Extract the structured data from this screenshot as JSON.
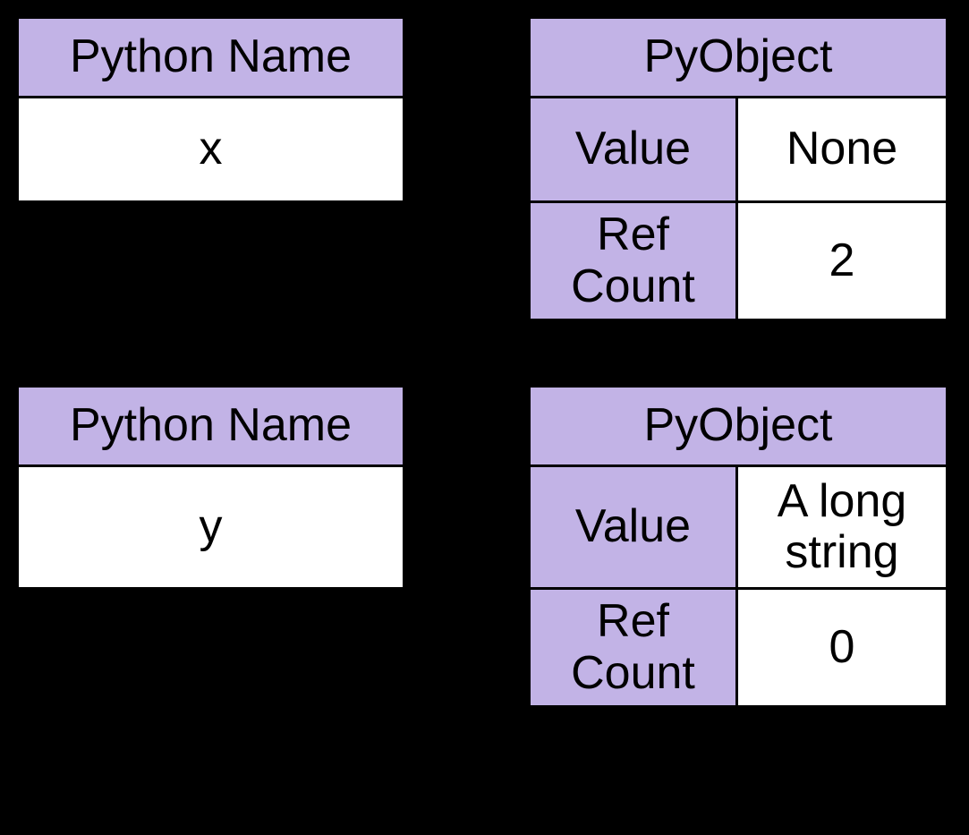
{
  "names": [
    {
      "header": "Python Name",
      "value": "x"
    },
    {
      "header": "Python Name",
      "value": "y"
    }
  ],
  "objects": [
    {
      "header": "PyObject",
      "rows": [
        {
          "label": "Value",
          "value": "None"
        },
        {
          "label": "Ref Count",
          "value": "2"
        }
      ]
    },
    {
      "header": "PyObject",
      "rows": [
        {
          "label": "Value",
          "value": "A long string"
        },
        {
          "label": "Ref Count",
          "value": "0"
        }
      ]
    }
  ]
}
